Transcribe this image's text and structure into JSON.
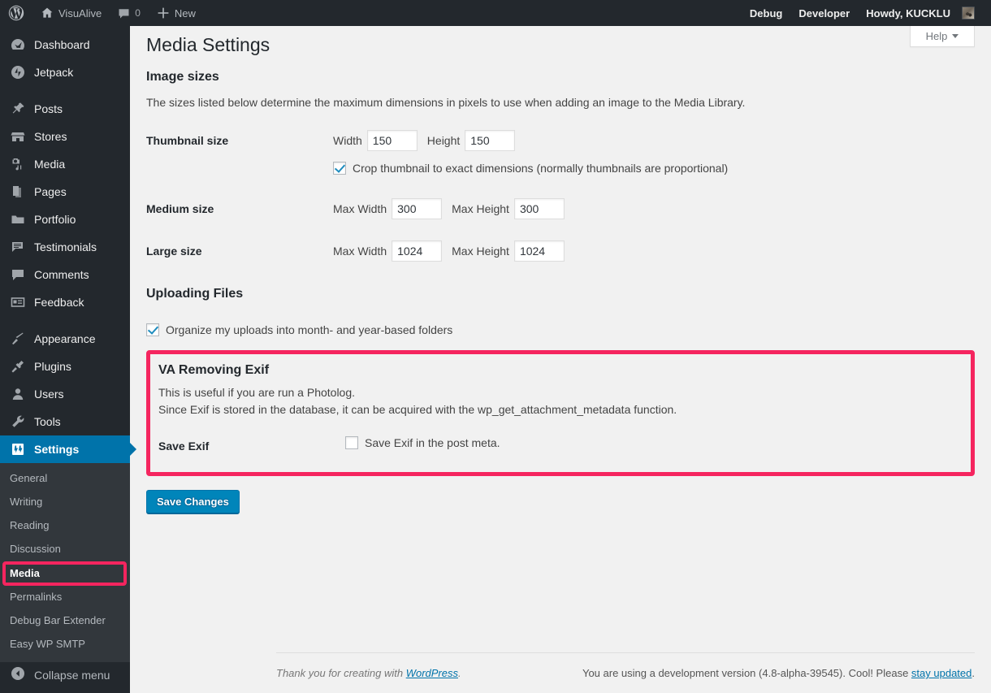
{
  "adminbar": {
    "left_items": [
      {
        "icon": "wordpress-logo-icon",
        "label": ""
      },
      {
        "icon": "home-icon",
        "label": "VisuAlive"
      },
      {
        "icon": "comment-bubble-icon",
        "label": "0"
      },
      {
        "icon": "plus-icon",
        "label": "New"
      }
    ],
    "site_name": "VisuAlive",
    "comment_count": "0",
    "new_label": "New",
    "right_items": [
      {
        "label": "Debug"
      },
      {
        "label": "Developer"
      },
      {
        "label": "Howdy, KUCKLU"
      }
    ],
    "debug_label": "Debug",
    "developer_label": "Developer",
    "howdy_label": "Howdy, KUCKLU"
  },
  "sidebar": {
    "items": [
      {
        "label": "Dashboard",
        "icon": "dashboard-icon"
      },
      {
        "label": "Jetpack",
        "icon": "jetpack-icon"
      },
      {
        "label": "Posts",
        "icon": "pin-icon"
      },
      {
        "label": "Stores",
        "icon": "store-icon"
      },
      {
        "label": "Media",
        "icon": "media-camera-icon"
      },
      {
        "label": "Pages",
        "icon": "pages-icon"
      },
      {
        "label": "Portfolio",
        "icon": "portfolio-icon"
      },
      {
        "label": "Testimonials",
        "icon": "testimonials-icon"
      },
      {
        "label": "Comments",
        "icon": "comment-icon"
      },
      {
        "label": "Feedback",
        "icon": "feedback-icon"
      },
      {
        "label": "Appearance",
        "icon": "appearance-brush-icon"
      },
      {
        "label": "Plugins",
        "icon": "plugin-plug-icon"
      },
      {
        "label": "Users",
        "icon": "user-icon"
      },
      {
        "label": "Tools",
        "icon": "wrench-icon"
      },
      {
        "label": "Settings",
        "icon": "settings-sliders-icon"
      }
    ],
    "submenu": [
      {
        "label": "General"
      },
      {
        "label": "Writing"
      },
      {
        "label": "Reading"
      },
      {
        "label": "Discussion"
      },
      {
        "label": "Media"
      },
      {
        "label": "Permalinks"
      },
      {
        "label": "Debug Bar Extender"
      },
      {
        "label": "Easy WP SMTP"
      }
    ],
    "collapse_label": "Collapse menu",
    "collapse_icon": "collapse-arrow-icon",
    "current_item": "Settings",
    "current_subitem": "Media",
    "highlight_color": "#f5255f",
    "accent_color": "#0073aa"
  },
  "help": {
    "label": "Help",
    "icon": "chevron-down-icon"
  },
  "main": {
    "page_title": "Media Settings",
    "image_sizes": {
      "heading": "Image sizes",
      "description": "The sizes listed below determine the maximum dimensions in pixels to use when adding an image to the Media Library.",
      "rows": [
        {
          "label": "Thumbnail size",
          "fields": [
            {
              "label": "Width",
              "value": "150"
            },
            {
              "label": "Height",
              "value": "150"
            }
          ],
          "checkbox": {
            "label": "Crop thumbnail to exact dimensions (normally thumbnails are proportional)",
            "checked": true
          }
        },
        {
          "label": "Medium size",
          "fields": [
            {
              "label": "Max Width",
              "value": "300"
            },
            {
              "label": "Max Height",
              "value": "300"
            }
          ],
          "checkbox": null
        },
        {
          "label": "Large size",
          "fields": [
            {
              "label": "Max Width",
              "value": "1024"
            },
            {
              "label": "Max Height",
              "value": "1024"
            }
          ],
          "checkbox": null
        }
      ]
    },
    "uploading_files": {
      "heading": "Uploading Files",
      "checkbox_label": "Organize my uploads into month- and year-based folders",
      "checked": true
    },
    "exif": {
      "heading": "VA Removing Exif",
      "description_line1": "This is useful if you are run a Photolog.",
      "description_line2": "Since Exif is stored in the database, it can be acquired with the wp_get_attachment_metadata function.",
      "row_label": "Save Exif",
      "checkbox_label": "Save Exif in the post meta.",
      "checked": false
    },
    "save_button": "Save Changes"
  },
  "footer": {
    "thanks_prefix": "Thank you for creating with ",
    "wordpress_link": "WordPress",
    "thanks_suffix": ".",
    "version_prefix": "You are using a development version (4.8-alpha-39545). Cool! Please ",
    "update_link": "stay updated",
    "version_suffix": "."
  }
}
